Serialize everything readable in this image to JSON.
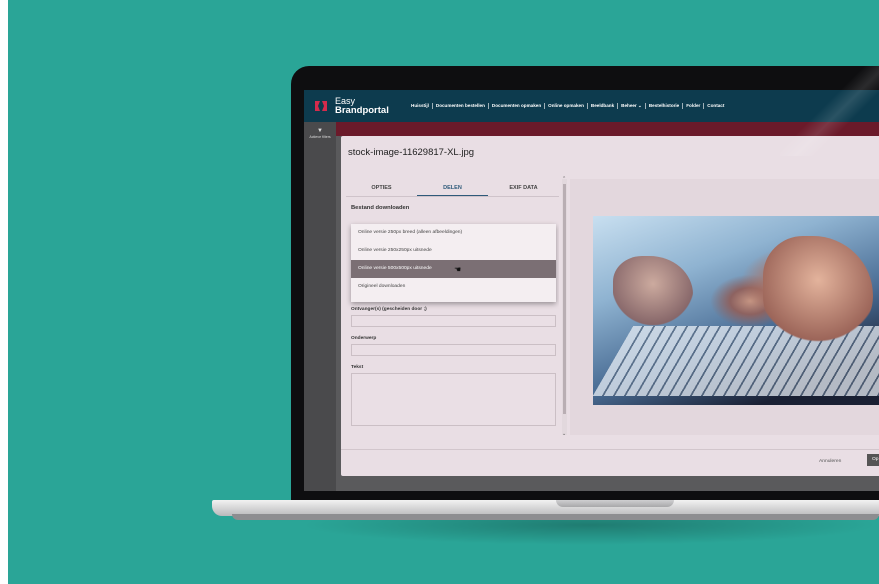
{
  "app": {
    "logo_line1": "Easy",
    "logo_line2": "Brandportal"
  },
  "nav": {
    "items": [
      "Huisstijl",
      "Documenten bestellen",
      "Documenten opmaken",
      "Online opmaken",
      "Beeldbank",
      "Beheer",
      "Bestelhistorie",
      "Folder",
      "Contact"
    ]
  },
  "sidebar": {
    "filter_label": "Actieve filters"
  },
  "modal": {
    "title": "stock-image-11629817-XL.jpg",
    "tabs": [
      "OPTIES",
      "DELEN",
      "EXIF DATA"
    ],
    "active_tab": "DELEN",
    "section_title": "Bestand downloaden",
    "dropdown": {
      "options": [
        "Online versie 250px breed (alleen afbeeldingen)",
        "Online versie 250x250px uitsnede",
        "Online versie 500x500px uitsnede",
        "Origineel downloaden"
      ],
      "selected_index": 2
    },
    "fields": {
      "recipients_label": "Ontvanger(s) (gescheiden door ;)",
      "subject_label": "Onderwerp",
      "text_label": "Tekst"
    },
    "footer": {
      "cancel_label": "Annuleren",
      "ok_label": "Op"
    }
  },
  "colors": {
    "background": "#2aa597",
    "nav": "#0d3b4e",
    "accent_red": "#6b1a2a",
    "logo_red": "#d52b4c"
  }
}
